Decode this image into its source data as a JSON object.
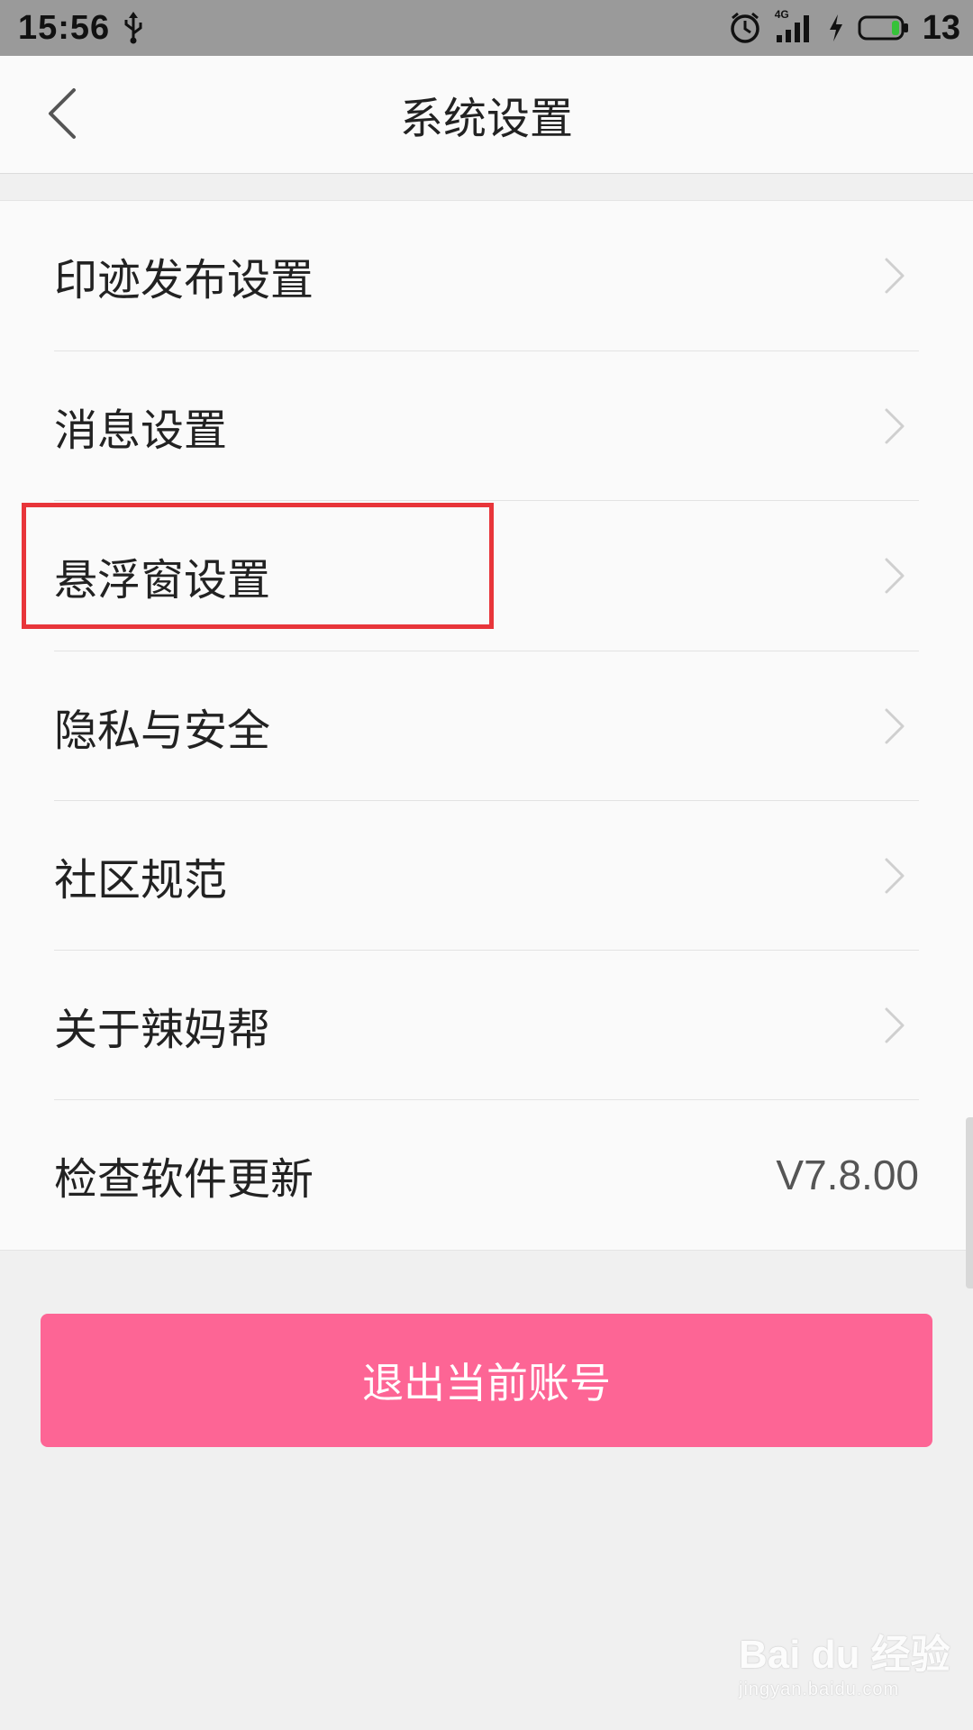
{
  "status_bar": {
    "time": "15:56",
    "network_label": "4G",
    "battery_percent": "13",
    "icons": [
      "usb-icon",
      "alarm-icon",
      "signal-icon",
      "charging-icon",
      "battery-icon"
    ]
  },
  "header": {
    "title": "系统设置",
    "back_icon": "chevron-left-icon"
  },
  "settings": {
    "items": [
      {
        "label": "印迹发布设置",
        "icon": "chevron-right-icon"
      },
      {
        "label": "消息设置",
        "icon": "chevron-right-icon"
      },
      {
        "label": "悬浮窗设置",
        "icon": "chevron-right-icon",
        "highlighted": true
      },
      {
        "label": "隐私与安全",
        "icon": "chevron-right-icon"
      },
      {
        "label": "社区规范",
        "icon": "chevron-right-icon"
      },
      {
        "label": "关于辣妈帮",
        "icon": "chevron-right-icon"
      },
      {
        "label": "检查软件更新",
        "value": "V7.8.00"
      }
    ]
  },
  "logout": {
    "label": "退出当前账号"
  },
  "watermark": {
    "brand": "Bai du 经验",
    "url": "jingyan.baidu.com"
  },
  "colors": {
    "accent_button": "#fd6595",
    "highlight_border": "#e8353a",
    "status_bar": "#9a9a9a",
    "battery_level": "#36c23a"
  }
}
